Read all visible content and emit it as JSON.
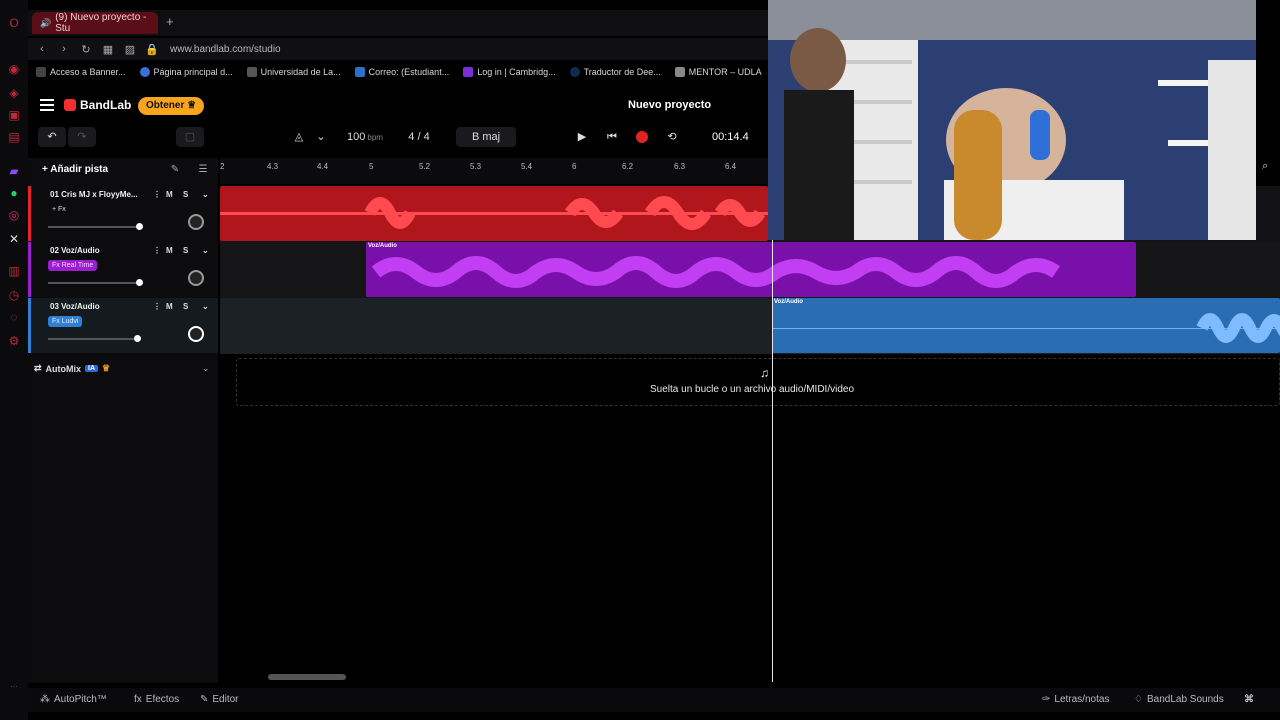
{
  "browser": {
    "tab_title": "(9) Nuevo proyecto - Stu",
    "url": "www.bandlab.com/studio",
    "bookmarks": [
      "Acceso a Banner...",
      "Página principal d...",
      "Universidad de La...",
      "Correo: (Estudiant...",
      "Log in | Cambridg...",
      "Traductor de Dee...",
      "MENTOR – UDLA"
    ]
  },
  "app": {
    "logo": "BandLab",
    "get_button": "Obtener",
    "project_title": "Nuevo proyecto"
  },
  "transport": {
    "bpm": "100",
    "bpm_unit": "bpm",
    "time_sig_top": "4",
    "time_sig_bottom": "4",
    "key": "B maj",
    "time": "00:14.4"
  },
  "tracks_panel": {
    "add_track": "Añadir pista",
    "automix": "AutoMix",
    "ia_badge": "IA"
  },
  "tracks": [
    {
      "name": "01  Cris MJ x FloyyMe...",
      "fx": "+ Fx",
      "mute": "M",
      "solo": "S",
      "color": "#e8222a",
      "volume": 0.82
    },
    {
      "name": "02  Voz/Audio",
      "fx": "Fx Real Time",
      "mute": "M",
      "solo": "S",
      "color": "#9c1ed1",
      "volume": 0.82
    },
    {
      "name": "03  Voz/Audio",
      "fx": "Fx Ludvi",
      "mute": "M",
      "solo": "S",
      "color": "#2f7fd2",
      "volume": 0.82
    }
  ],
  "ruler_ticks": [
    "2",
    "4.3",
    "4.4",
    "5",
    "5.2",
    "5.3",
    "5.4",
    "6",
    "6.2",
    "6.3",
    "6.4"
  ],
  "clips": [
    {
      "label": "Voz/Audio"
    },
    {
      "label": "Voz/Audio"
    }
  ],
  "drop_zone_text": "Suelta un bucle o un archivo audio/MIDI/video",
  "bottom_bar": {
    "autopitch": "AutoPitch™",
    "effects": "Efectos",
    "editor": "Editor",
    "lyrics": "Letras/notas",
    "sounds": "BandLab Sounds"
  }
}
